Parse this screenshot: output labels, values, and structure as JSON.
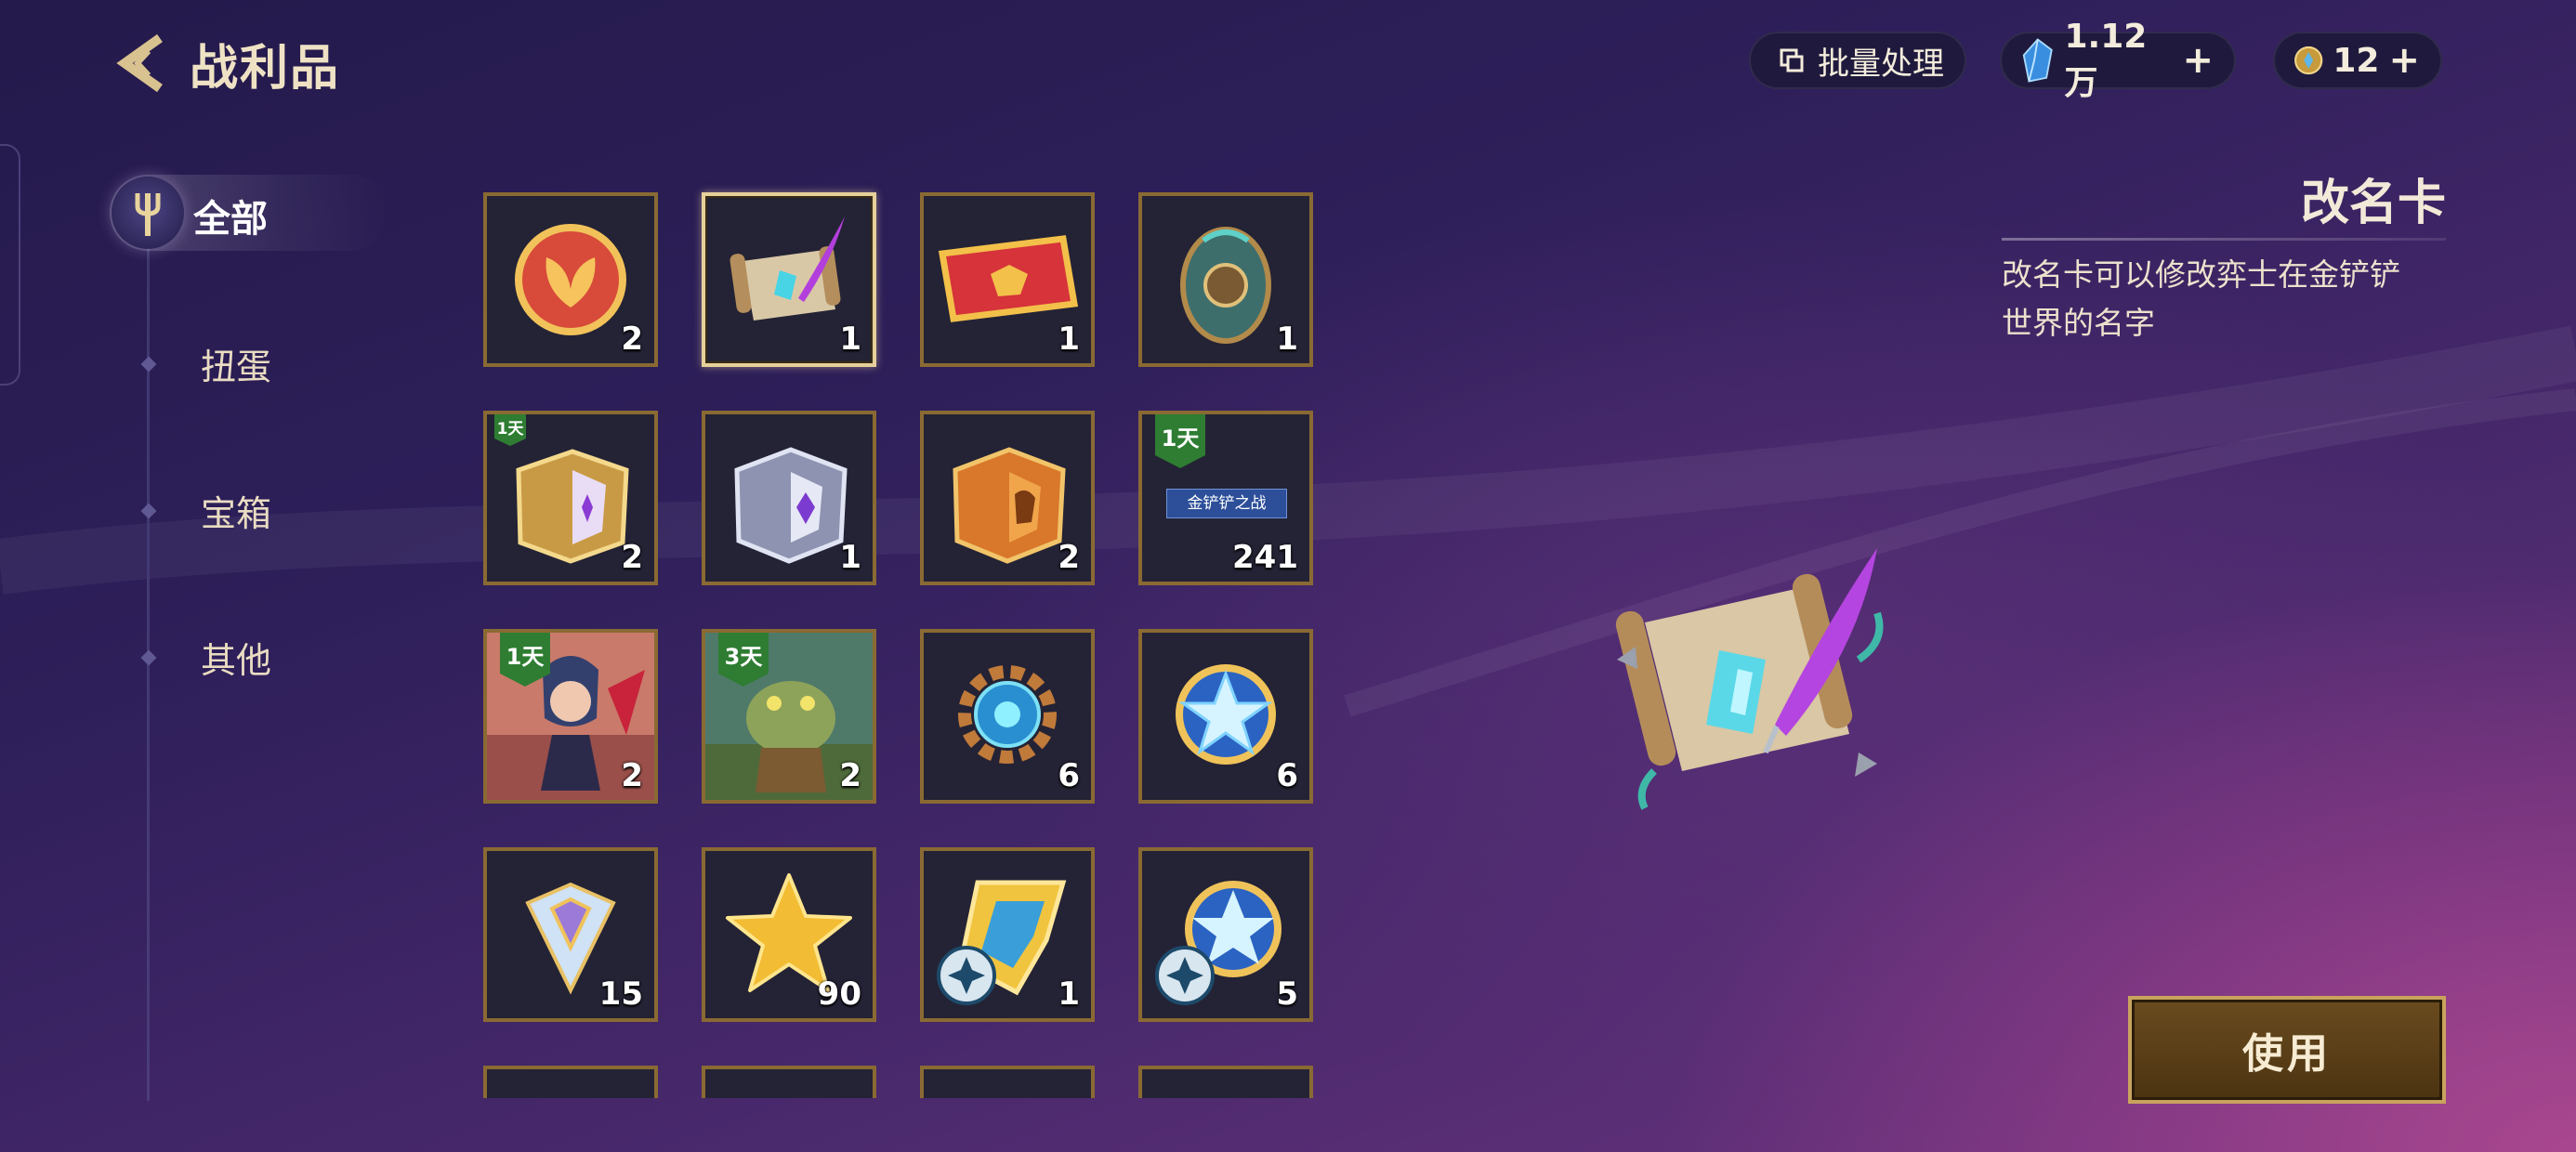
{
  "header": {
    "title": "战利品",
    "batch_label": "批量处理",
    "gems_amount": "1.12万",
    "coins_amount": "12"
  },
  "sidebar": {
    "items": [
      {
        "label": "全部",
        "active": true
      },
      {
        "label": "扭蛋",
        "active": false
      },
      {
        "label": "宝箱",
        "active": false
      },
      {
        "label": "其他",
        "active": false
      }
    ]
  },
  "grid": {
    "items": [
      {
        "icon": "red-emblem-icon",
        "count": "2"
      },
      {
        "icon": "rename-scroll-icon",
        "count": "1",
        "selected": true
      },
      {
        "icon": "red-ticket-icon",
        "count": "1"
      },
      {
        "icon": "jade-egg-icon",
        "count": "1"
      },
      {
        "icon": "gold-purple-chest-icon",
        "count": "2",
        "tag": "1天"
      },
      {
        "icon": "silver-chest-icon",
        "count": "1"
      },
      {
        "icon": "orange-chest-icon",
        "count": "2"
      },
      {
        "icon": "event-ticket-icon",
        "count": "241",
        "tag": "1天",
        "ribbon": "金铲铲之战"
      },
      {
        "icon": "champion-portrait-icon",
        "count": "2",
        "tag": "1天"
      },
      {
        "icon": "toad-portrait-icon",
        "count": "2",
        "tag": "3天"
      },
      {
        "icon": "blue-gear-icon",
        "count": "6"
      },
      {
        "icon": "star-medal-icon",
        "count": "6"
      },
      {
        "icon": "diamond-icon",
        "count": "15"
      },
      {
        "icon": "gold-star-icon",
        "count": "90"
      },
      {
        "icon": "gold-badge-icon",
        "count": "1"
      },
      {
        "icon": "star-medal-plus-icon",
        "count": "5"
      }
    ]
  },
  "detail": {
    "title": "改名卡",
    "description": "改名卡可以修改弈士在金铲铲世界的名字",
    "use_label": "使用"
  },
  "colors": {
    "accent_gold": "#8a6a33",
    "selected_border": "#e6d09a",
    "tag_green": "#2e7d32"
  }
}
